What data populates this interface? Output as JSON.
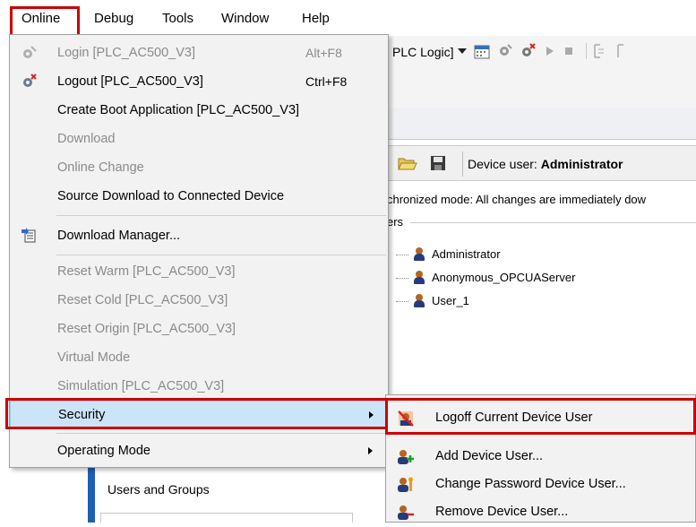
{
  "menubar": {
    "items": [
      "Online",
      "Debug",
      "Tools",
      "Window",
      "Help"
    ]
  },
  "toolbar": {
    "context_label": "PLC Logic]"
  },
  "device_bar": {
    "label_prefix": "Device user:",
    "label_user": "Administrator"
  },
  "sync_text": "chronized mode: All changes are immediately dow",
  "users_header": "ers",
  "users": [
    "Administrator",
    "Anonymous_OPCUAServer",
    "User_1"
  ],
  "left_pane": {
    "users_and_groups": "Users and Groups"
  },
  "online_menu": {
    "items": [
      {
        "label": "Login [PLC_AC500_V3]",
        "shortcut": "Alt+F8",
        "enabled": false
      },
      {
        "label": "Logout [PLC_AC500_V3]",
        "shortcut": "Ctrl+F8",
        "enabled": true
      },
      {
        "label": "Create Boot Application [PLC_AC500_V3]",
        "shortcut": "",
        "enabled": true
      },
      {
        "label": "Download",
        "shortcut": "",
        "enabled": false
      },
      {
        "label": "Online Change",
        "shortcut": "",
        "enabled": false
      },
      {
        "label": "Source Download to Connected Device",
        "shortcut": "",
        "enabled": true
      },
      {
        "label": "Download Manager...",
        "shortcut": "",
        "enabled": true
      },
      {
        "label": "Reset Warm [PLC_AC500_V3]",
        "shortcut": "",
        "enabled": false
      },
      {
        "label": "Reset Cold [PLC_AC500_V3]",
        "shortcut": "",
        "enabled": false
      },
      {
        "label": "Reset Origin [PLC_AC500_V3]",
        "shortcut": "",
        "enabled": false
      },
      {
        "label": "Virtual Mode",
        "shortcut": "",
        "enabled": false
      },
      {
        "label": "Simulation [PLC_AC500_V3]",
        "shortcut": "",
        "enabled": false
      },
      {
        "label": "Security",
        "shortcut": "",
        "enabled": true,
        "highlighted": true,
        "has_submenu": true
      },
      {
        "label": "Operating Mode",
        "shortcut": "",
        "enabled": true,
        "has_submenu": true
      }
    ]
  },
  "security_submenu": {
    "items": [
      {
        "label": "Logoff Current Device User",
        "icon": "logoff-user-icon"
      },
      {
        "label": "Add Device User...",
        "icon": "add-user-icon"
      },
      {
        "label": "Change Password Device User...",
        "icon": "change-password-user-icon"
      },
      {
        "label": "Remove Device User...",
        "icon": "remove-user-icon"
      }
    ]
  },
  "colors": {
    "highlight_bg": "#cce4f7",
    "highlight_border": "#99c9ef",
    "annotation_red": "#cc0000",
    "disabled_text": "#8a8a8a"
  }
}
